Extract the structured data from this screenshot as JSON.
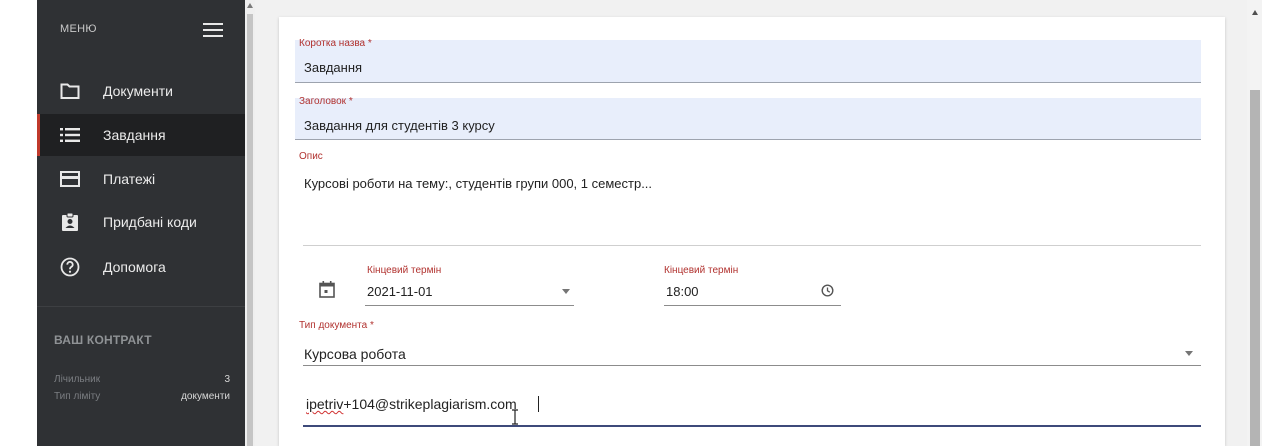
{
  "sidebar": {
    "menu_label": "МЕНЮ",
    "items": [
      {
        "label": "Документи",
        "icon": "folder-icon",
        "active": false
      },
      {
        "label": "Завдання",
        "icon": "list-icon",
        "active": true
      },
      {
        "label": "Платежі",
        "icon": "credit-card-icon",
        "active": false
      },
      {
        "label": "Придбані коди",
        "icon": "clipboard-account-icon",
        "active": false
      },
      {
        "label": "Допомога",
        "icon": "help-circle-icon",
        "active": false
      }
    ],
    "contract": {
      "title": "ВАШ КОНТРАКТ",
      "counter_label": "Лічильник",
      "counter_value": "3",
      "limit_type_label": "Тип ліміту",
      "limit_type_value": "документи"
    }
  },
  "form": {
    "short_name": {
      "label": "Коротка назва",
      "required_mark": "*",
      "value": "Завдання"
    },
    "heading": {
      "label": "Заголовок",
      "required_mark": "*",
      "value": "Завдання для студентів 3 курсу"
    },
    "description": {
      "label": "Опис",
      "value": "Курсові роботи на тему:, студентів групи 000, 1 семестр..."
    },
    "deadline_date": {
      "label": "Кінцевий термін",
      "value": "2021-11-01",
      "icon": "calendar-icon"
    },
    "deadline_time": {
      "label": "Кінцевий термін",
      "value": "18:00",
      "icon": "clock-icon"
    },
    "document_type": {
      "label": "Тип документа",
      "required_mark": "*",
      "value": "Курсова робота"
    },
    "email": {
      "value_misspelled": "ipetriv",
      "value_rest": "+104@strikeplagiarism.com"
    }
  },
  "colors": {
    "sidebar_bg": "#2f3134",
    "active_accent": "#c0392b",
    "required_label": "#b1322f",
    "filled_bg": "#e8eefb",
    "focus_line": "#3d4a7a"
  }
}
